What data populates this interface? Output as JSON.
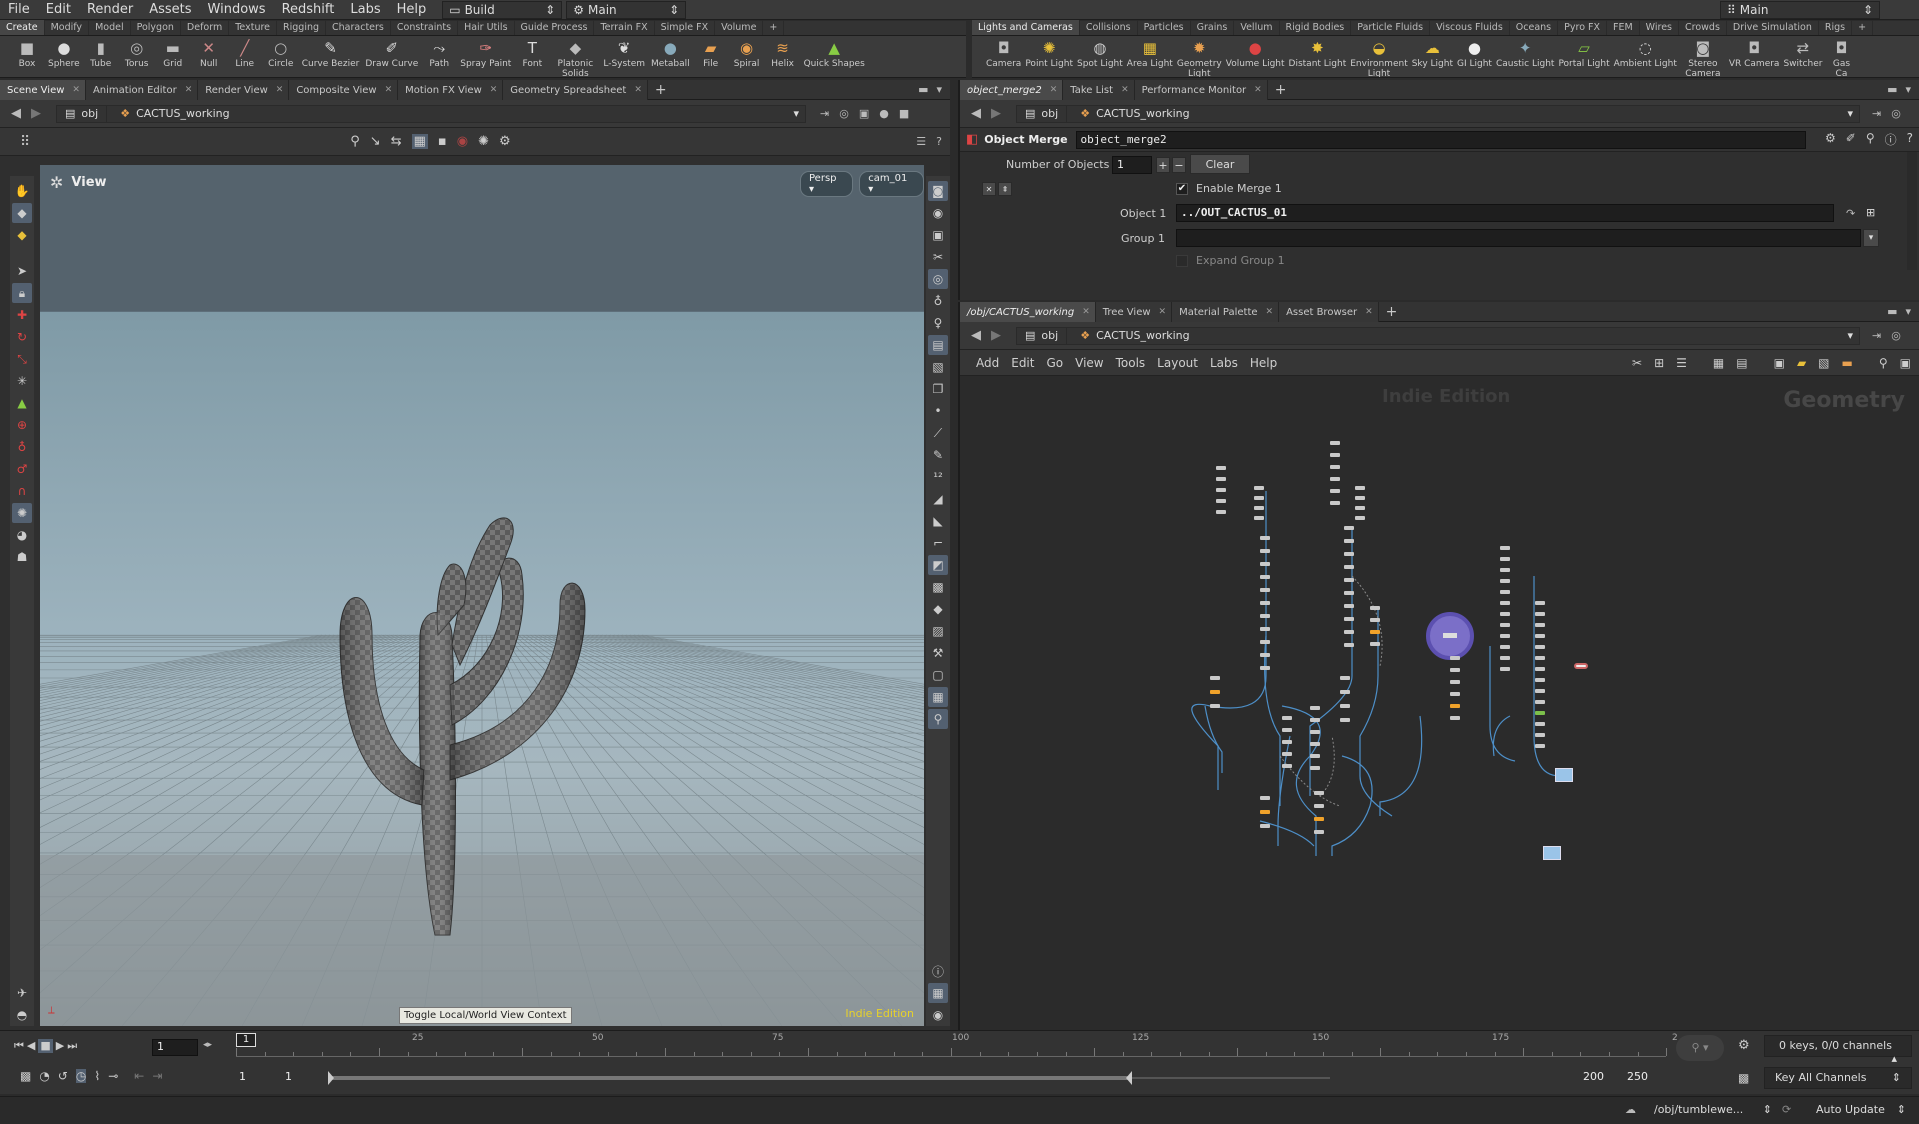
{
  "menubar": {
    "items": [
      "File",
      "Edit",
      "Render",
      "Assets",
      "Windows",
      "Redshift",
      "Labs",
      "Help"
    ],
    "desktop": "Build",
    "context": "Main",
    "right_context": "Main"
  },
  "shelf_left": {
    "tabs": [
      "Create",
      "Modify",
      "Model",
      "Polygon",
      "Deform",
      "Texture",
      "Rigging",
      "Characters",
      "Constraints",
      "Hair Utils",
      "Guide Process",
      "Terrain FX",
      "Simple FX",
      "Volume"
    ],
    "tools": [
      {
        "label": "Box",
        "icon": "box-icon",
        "glyph": "■"
      },
      {
        "label": "Sphere",
        "icon": "sphere-icon",
        "glyph": "●"
      },
      {
        "label": "Tube",
        "icon": "tube-icon",
        "glyph": "▮"
      },
      {
        "label": "Torus",
        "icon": "torus-icon",
        "glyph": "◎"
      },
      {
        "label": "Grid",
        "icon": "grid-icon",
        "glyph": "▬"
      },
      {
        "label": "Null",
        "icon": "null-icon",
        "glyph": "✕"
      },
      {
        "label": "Line",
        "icon": "line-icon",
        "glyph": "╱"
      },
      {
        "label": "Circle",
        "icon": "circle-icon",
        "glyph": "○"
      },
      {
        "label": "Curve Bezier",
        "icon": "curve-bezier-icon",
        "glyph": "✎"
      },
      {
        "label": "Draw Curve",
        "icon": "draw-curve-icon",
        "glyph": "✐"
      },
      {
        "label": "Path",
        "icon": "path-icon",
        "glyph": "⤳"
      },
      {
        "label": "Spray Paint",
        "icon": "spray-paint-icon",
        "glyph": "✑"
      },
      {
        "label": "Font",
        "icon": "font-icon",
        "glyph": "T"
      },
      {
        "label": "Platonic\nSolids",
        "icon": "platonic-solids-icon",
        "glyph": "◆"
      },
      {
        "label": "L-System",
        "icon": "l-system-icon",
        "glyph": "❦"
      },
      {
        "label": "Metaball",
        "icon": "metaball-icon",
        "glyph": "●"
      },
      {
        "label": "File",
        "icon": "file-icon",
        "glyph": "▰"
      },
      {
        "label": "Spiral",
        "icon": "spiral-icon",
        "glyph": "◉"
      },
      {
        "label": "Helix",
        "icon": "helix-icon",
        "glyph": "≋"
      },
      {
        "label": "Quick Shapes",
        "icon": "quick-shapes-icon",
        "glyph": "▲"
      }
    ]
  },
  "shelf_right": {
    "tabs": [
      "Lights and Cameras",
      "Collisions",
      "Particles",
      "Grains",
      "Vellum",
      "Rigid Bodies",
      "Particle Fluids",
      "Viscous Fluids",
      "Oceans",
      "Pyro FX",
      "FEM",
      "Wires",
      "Crowds",
      "Drive Simulation",
      "Rigs"
    ],
    "tools": [
      {
        "label": "Camera",
        "icon": "camera-icon",
        "glyph": "◘"
      },
      {
        "label": "Point Light",
        "icon": "point-light-icon",
        "glyph": "✺"
      },
      {
        "label": "Spot Light",
        "icon": "spot-light-icon",
        "glyph": "◍"
      },
      {
        "label": "Area Light",
        "icon": "area-light-icon",
        "glyph": "▦"
      },
      {
        "label": "Geometry\nLight",
        "icon": "geometry-light-icon",
        "glyph": "✹"
      },
      {
        "label": "Volume Light",
        "icon": "volume-light-icon",
        "glyph": "●"
      },
      {
        "label": "Distant Light",
        "icon": "distant-light-icon",
        "glyph": "✸"
      },
      {
        "label": "Environment\nLight",
        "icon": "environment-light-icon",
        "glyph": "◒"
      },
      {
        "label": "Sky Light",
        "icon": "sky-light-icon",
        "glyph": "☁"
      },
      {
        "label": "GI Light",
        "icon": "gi-light-icon",
        "glyph": "●"
      },
      {
        "label": "Caustic Light",
        "icon": "caustic-light-icon",
        "glyph": "✦"
      },
      {
        "label": "Portal Light",
        "icon": "portal-light-icon",
        "glyph": "▱"
      },
      {
        "label": "Ambient Light",
        "icon": "ambient-light-icon",
        "glyph": "◌"
      },
      {
        "label": "Stereo\nCamera",
        "icon": "stereo-camera-icon",
        "glyph": "◙"
      },
      {
        "label": "VR Camera",
        "icon": "vr-camera-icon",
        "glyph": "◘"
      },
      {
        "label": "Switcher",
        "icon": "switcher-icon",
        "glyph": "⇄"
      },
      {
        "label": "Gas\nCa",
        "icon": "gas-camera-icon",
        "glyph": "◘"
      }
    ]
  },
  "left_pane": {
    "tabs": [
      "Scene View",
      "Animation Editor",
      "Render View",
      "Composite View",
      "Motion FX View",
      "Geometry Spreadsheet"
    ],
    "path_obj": "obj",
    "path_node": "CACTUS_working",
    "view_label": "View",
    "persp": "Persp",
    "camera": "cam_01",
    "tooltip": "Toggle Local/World View Context",
    "watermark": "Indie Edition"
  },
  "params_pane": {
    "tabs": [
      "object_merge2",
      "Take List",
      "Performance Monitor"
    ],
    "path_obj": "obj",
    "path_node": "CACTUS_working",
    "node_type": "Object Merge",
    "node_name": "object_merge2",
    "num_objects_label": "Number of Objects",
    "num_objects": "1",
    "clear_label": "Clear",
    "enable_merge_label": "Enable Merge 1",
    "object1_label": "Object 1",
    "object1_value": "../OUT_CACTUS_01",
    "group1_label": "Group 1",
    "group1_value": "",
    "expand_group_label": "Expand Group 1"
  },
  "network_pane": {
    "tabs": [
      "/obj/CACTUS_working",
      "Tree View",
      "Material Palette",
      "Asset Browser"
    ],
    "path_obj": "obj",
    "path_node": "CACTUS_working",
    "menu": [
      "Add",
      "Edit",
      "Go",
      "View",
      "Tools",
      "Layout",
      "Labs",
      "Help"
    ],
    "watermark": "Indie Edition",
    "context_label": "Geometry"
  },
  "timeline": {
    "current_frame": "1",
    "frame_marker": "1",
    "ticks": [
      "25",
      "50",
      "75",
      "100",
      "125",
      "150",
      "175",
      "2"
    ],
    "start": "1",
    "start2": "1",
    "end": "200",
    "end2": "250",
    "current_fraction": 0.0,
    "range_fraction": 0.8,
    "keys_label": "0 keys, 0/0 channels",
    "key_all_label": "Key All Channels"
  },
  "statusbar": {
    "path": "/obj/tumblewe...",
    "update_mode": "Auto Update"
  },
  "colors": {
    "accent": "#f0a22a",
    "selected_node": "#7b6fc8",
    "sky_top": "#55636d",
    "watermark_yellow": "#e8d22a"
  }
}
